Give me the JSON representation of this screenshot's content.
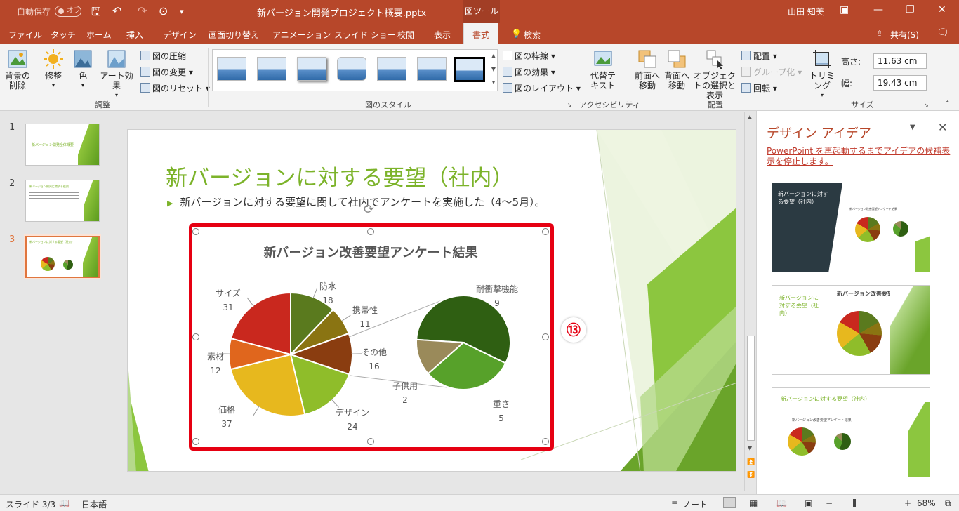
{
  "titlebar": {
    "autosave_label": "自動保存",
    "autosave_state": "オフ",
    "document": "新バージョン開発プロジェクト概要.pptx",
    "context_tool": "図ツール",
    "user": "山田 知美"
  },
  "tabs": [
    {
      "label": "ファイル"
    },
    {
      "label": "タッチ"
    },
    {
      "label": "ホーム"
    },
    {
      "label": "挿入"
    },
    {
      "label": "デザイン"
    },
    {
      "label": "画面切り替え"
    },
    {
      "label": "アニメーション"
    },
    {
      "label": "スライド ショー"
    },
    {
      "label": "校閲"
    },
    {
      "label": "表示"
    },
    {
      "label": "書式"
    }
  ],
  "tell_me": "検索",
  "share": "共有(S)",
  "ribbon": {
    "adjust": {
      "remove_bg": "背景の削除",
      "corrections": "修整",
      "color": "色",
      "artistic": "アート効果",
      "compress": "図の圧縮",
      "change": "図の変更",
      "reset": "図のリセット",
      "label": "調整"
    },
    "styles": {
      "border": "図の枠線",
      "effects": "図の効果",
      "layout": "図のレイアウト",
      "label": "図のスタイル"
    },
    "accessibility": {
      "alt_text": "代替テキスト",
      "label": "アクセシビリティ"
    },
    "arrange": {
      "forward": "前面へ移動",
      "backward": "背面へ移動",
      "selection": "オブジェクトの選択と表示",
      "align": "配置",
      "group": "グループ化",
      "rotate": "回転",
      "label": "配置"
    },
    "size": {
      "crop": "トリミング",
      "height_label": "高さ:",
      "height": "11.63 cm",
      "width_label": "幅:",
      "width": "19.43 cm",
      "label": "サイズ"
    }
  },
  "thumbs": [
    {
      "num": "1",
      "text": "新バージョン開発全体概要"
    },
    {
      "num": "2",
      "text": "新バージョン開発に関する役割"
    },
    {
      "num": "3",
      "text": "新バージョンに対する要望（社内）"
    }
  ],
  "slide": {
    "title": "新バージョンに対する要望（社内）",
    "bullet": "新バージョンに対する要望に関して社内でアンケートを実施した（4〜5月）。"
  },
  "callout": "⑬",
  "chart_data": {
    "type": "pie",
    "title": "新バージョン改善要望アンケート結果",
    "categories": [
      "防水",
      "携帯性",
      "その他",
      "デザイン",
      "価格",
      "素材",
      "サイズ"
    ],
    "values": [
      18,
      11,
      16,
      24,
      37,
      12,
      31
    ],
    "colors": [
      "#5a7a1e",
      "#8a7412",
      "#8a3d10",
      "#8fbd2a",
      "#e7b81e",
      "#e0661d",
      "#c9281e"
    ],
    "secondary": {
      "categories": [
        "耐衝撃機能",
        "重さ",
        "子供用"
      ],
      "values": [
        9,
        5,
        2
      ],
      "colors": [
        "#2f5f12",
        "#57a12a",
        "#9a8a5a"
      ]
    }
  },
  "ideas": {
    "title": "デザイン アイデア",
    "message": "PowerPoint を再起動するまでアイデアの候補表示を停止します。",
    "card_title": "新バージョンに対する要望（社内）",
    "card_chart_title": "新バージョン改善要望アンケート結果"
  },
  "status": {
    "slide": "スライド 3/3",
    "language": "日本語",
    "notes": "ノート",
    "zoom": "68%"
  }
}
